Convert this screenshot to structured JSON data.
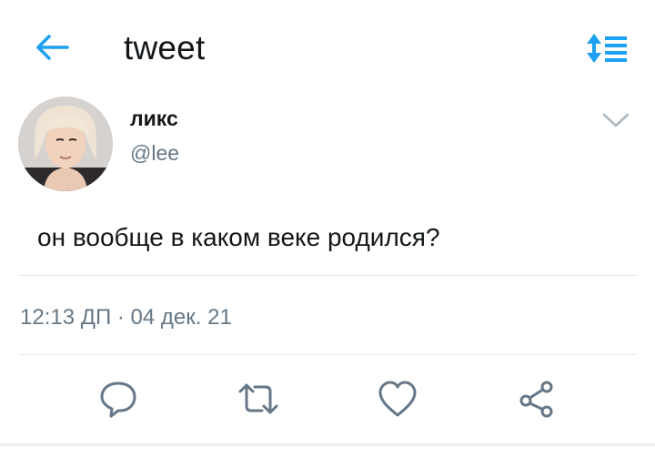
{
  "header": {
    "title": "tweet",
    "back_icon": "arrow-left-icon",
    "sort_icon": "sort-list-icon"
  },
  "tweet": {
    "author_name": "ликс",
    "author_handle": "@lee",
    "text": "он вообще в каком веке родился?",
    "timestamp": "12:13 ДП · 04 дек. 21",
    "menu_icon": "chevron-down-icon"
  },
  "actions": [
    {
      "name": "reply",
      "icon": "comment-icon"
    },
    {
      "name": "retweet",
      "icon": "retweet-icon"
    },
    {
      "name": "like",
      "icon": "heart-icon"
    },
    {
      "name": "share",
      "icon": "share-icon"
    }
  ],
  "colors": {
    "accent": "#1da1f2",
    "text": "#14171a",
    "secondary_text": "#657786",
    "icon_gray": "#657786",
    "divider": "#e1e8ed"
  }
}
